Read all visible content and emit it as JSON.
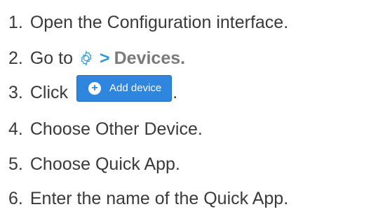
{
  "steps": [
    {
      "number": "1.",
      "text": "Open the Configuration interface."
    },
    {
      "number": "2.",
      "prefix": "Go to",
      "icon": "gear-icon",
      "separator": ">",
      "destination": "Devices."
    },
    {
      "number": "3.",
      "prefix": "Click",
      "button_label": "Add device",
      "button_icon": "plus-circle-icon",
      "suffix": "."
    },
    {
      "number": "4.",
      "text": "Choose Other Device."
    },
    {
      "number": "5.",
      "text": "Choose Quick App."
    },
    {
      "number": "6.",
      "text": "Enter the name of the Quick App."
    }
  ],
  "colors": {
    "text": "#3a3a3a",
    "accent": "#2b9bd6",
    "button": "#2e86de",
    "destination": "#7a7a7a"
  }
}
